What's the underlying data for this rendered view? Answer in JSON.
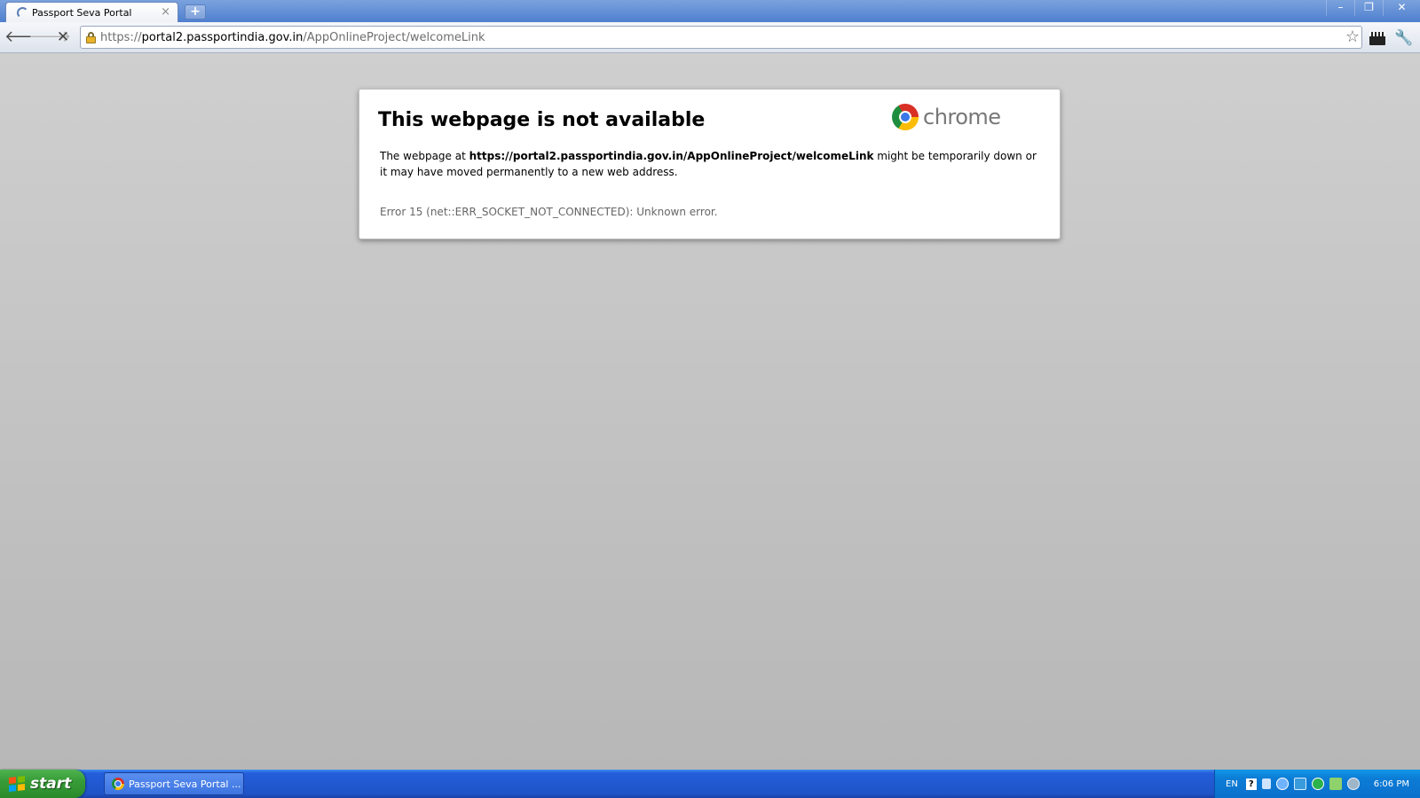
{
  "tab": {
    "title": "Passport Seva Portal",
    "close_glyph": "×"
  },
  "new_tab_glyph": "+",
  "window_controls": {
    "minimize": "–",
    "restore": "❐",
    "close": "✕"
  },
  "toolbar": {
    "back_glyph": "🡐",
    "forward_glyph": "🡒",
    "stop_glyph": "✕",
    "star_glyph": "☆",
    "wrench_glyph": "🔧"
  },
  "omnibox": {
    "scheme": "https://",
    "host": "portal2.passportindia.gov.in",
    "path": "/AppOnlineProject/welcomeLink"
  },
  "error_page": {
    "title": "This webpage is not available",
    "brand": "chrome",
    "description_prefix": "The webpage at ",
    "description_url": "https://portal2.passportindia.gov.in/AppOnlineProject/welcomeLink",
    "description_suffix": " might be temporarily down or it may have moved permanently to a new web address.",
    "error_code": "Error 15 (net::ERR_SOCKET_NOT_CONNECTED): Unknown error."
  },
  "taskbar": {
    "start_label": "start",
    "task_label": "Passport Seva Portal ...",
    "tray_language": "EN",
    "tray_help": "?",
    "clock": "6:06 PM"
  }
}
